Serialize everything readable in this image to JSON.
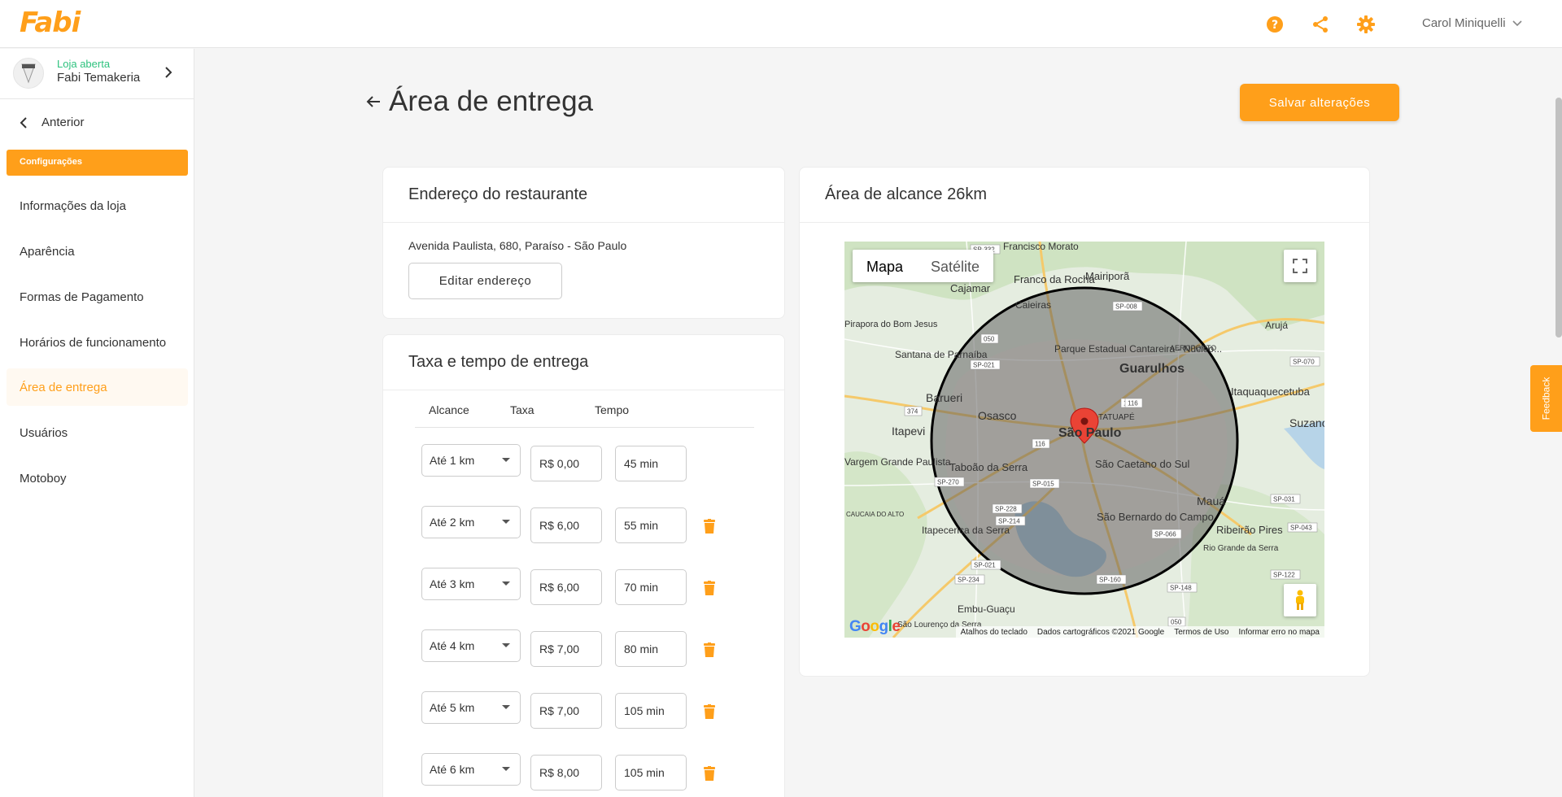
{
  "app": {
    "logo": "Fabi"
  },
  "header": {
    "user_name": "Carol Miniquelli"
  },
  "store": {
    "status": "Loja aberta",
    "name": "Fabi Temakeria"
  },
  "sidebar": {
    "back_label": "Anterior",
    "section_label": "Configurações",
    "items": [
      {
        "label": "Informações da loja"
      },
      {
        "label": "Aparência"
      },
      {
        "label": "Formas de Pagamento"
      },
      {
        "label": "Horários de funcionamento"
      },
      {
        "label": "Área de entrega",
        "active": true
      },
      {
        "label": "Usuários"
      },
      {
        "label": "Motoboy"
      }
    ]
  },
  "page": {
    "title": "Área de entrega",
    "save_label": "Salvar alterações"
  },
  "address_card": {
    "title": "Endereço do restaurante",
    "address": "Avenida Paulista, 680, Paraíso - São Paulo",
    "edit_label": "Editar endereço"
  },
  "fees_card": {
    "title": "Taxa e tempo de entrega",
    "columns": {
      "range": "Alcance",
      "fee": "Taxa",
      "time": "Tempo"
    },
    "rows": [
      {
        "range": "Até 1 km",
        "fee": "R$ 0,00",
        "time": "45 min"
      },
      {
        "range": "Até 2 km",
        "fee": "R$ 6,00",
        "time": "55 min"
      },
      {
        "range": "Até 3 km",
        "fee": "R$ 6,00",
        "time": "70 min"
      },
      {
        "range": "Até 4 km",
        "fee": "R$ 7,00",
        "time": "80 min"
      },
      {
        "range": "Até 5 km",
        "fee": "R$ 7,00",
        "time": "105 min"
      },
      {
        "range": "Até 6 km",
        "fee": "R$ 8,00",
        "time": "105 min"
      }
    ]
  },
  "map_card": {
    "title": "Área de alcance 26km",
    "map_type": {
      "map": "Mapa",
      "satellite": "Satélite"
    },
    "labels": {
      "center": "São Paulo",
      "guarulhos": "Guarulhos",
      "osasco": "Osasco",
      "barueri": "Barueri",
      "taboao": "Taboão da Serra",
      "sao_caetano": "São Caetano do Sul",
      "sao_bernardo": "São Bernardo do Campo",
      "maua": "Mauá",
      "suzano": "Suzano",
      "itapevi": "Itapevi",
      "itaqua": "Itaquaquecetuba",
      "ribeirao": "Ribeirão Pires",
      "franco": "Franco da Rocha",
      "mairipora": "Mairiporã",
      "cajamar": "Cajamar",
      "santana": "Santana de Parnaíba",
      "caieiras": "Caieiras",
      "aruja": "Arujá",
      "embu": "Embu-Guaçu",
      "vargem": "Vargem Grande Paulista",
      "itapecerica": "Itapecerica da Serra",
      "parque": "Parque Estadual Cantareira - Núcleo...",
      "francisco": "Francisco Morato",
      "pirapora": "Pirapora do Bom Jesus",
      "rio_grande": "Rio Grande da Serra",
      "tatuape": "TATUAPÉ",
      "aeroporto": "AEROPORTO",
      "cachoeira": "CAUCAIA DO ALTO",
      "sao_lourenco": "São Lourenço da Serra"
    },
    "road_labels": [
      "SP-332",
      "SP-008",
      "SP-070",
      "SP-021",
      "050",
      "374",
      "116",
      "SP-270",
      "SP-015",
      "SP-228",
      "SP-214",
      "SP-021",
      "SP-160",
      "SP-148",
      "SP-234",
      "050",
      "SP-031",
      "SP-043",
      "SP-122",
      "SP-066",
      "116",
      "116"
    ],
    "footer": {
      "shortcuts": "Atalhos do teclado",
      "data": "Dados cartográficos ©2021 Google",
      "terms": "Termos de Uso",
      "report": "Informar erro no mapa"
    },
    "google": "Google"
  },
  "feedback": "Feedback",
  "colors": {
    "brand": "#ff9f1a",
    "status_open": "#2ec27e"
  }
}
